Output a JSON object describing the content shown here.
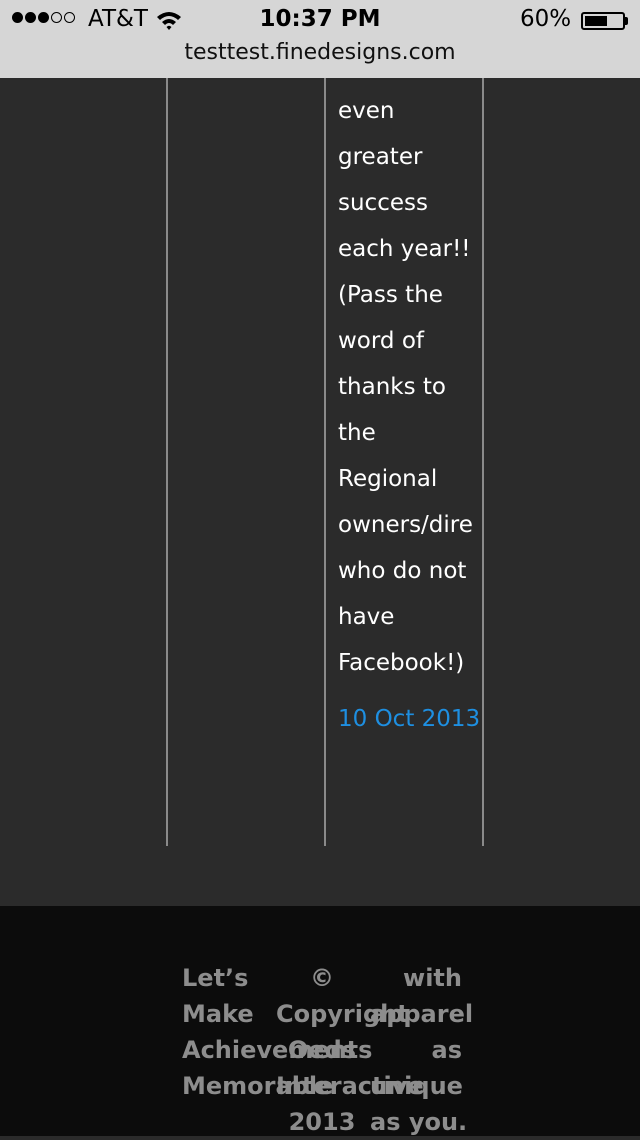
{
  "status_bar": {
    "carrier": "AT&T",
    "time": "10:37 PM",
    "battery_percent": "60%",
    "battery_level": 0.6,
    "signal_bars": 3,
    "signal_total": 5
  },
  "browser": {
    "url": "testtest.finedesigns.com"
  },
  "post": {
    "lines": [
      "even",
      "greater",
      "success",
      "each year!!",
      "(Pass the",
      "word of",
      "thanks to",
      "the",
      "Regional",
      "owners/dire",
      "who do not",
      "have",
      "Facebook!)"
    ],
    "date": "10 Oct 2013"
  },
  "footer": {
    "col_a": [
      "Let’s",
      "Make",
      "Achievements",
      "Memorable"
    ],
    "col_b": [
      "©",
      "Copyright",
      "Oeds",
      "Interactive",
      "2013"
    ],
    "col_c": [
      "with",
      "apparel",
      "as",
      "unique",
      "as you."
    ]
  },
  "colors": {
    "background": "#2b2b2b",
    "footer_background": "#0c0c0c",
    "link": "#1e8fe1",
    "footer_text": "#8d8d8d"
  }
}
